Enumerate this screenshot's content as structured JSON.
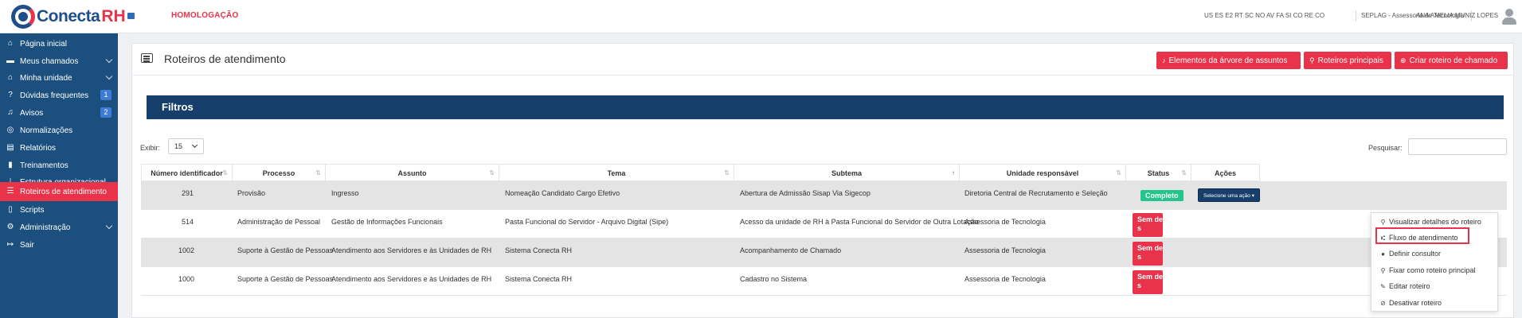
{
  "header": {
    "logo_text": "Conecta",
    "logo_rh": "RH",
    "environment": "HOMOLOGAÇÃO",
    "codes": "US ES E2 RT SC NO AV FA SI CO RE CO",
    "org": "SEPLAG - Assessoria de Tecnologia",
    "user": "ANA AMELIA MUNIZ LOPES"
  },
  "sidebar": {
    "items": [
      {
        "label": "Página inicial",
        "icon": "home-icon"
      },
      {
        "label": "Meus chamados",
        "icon": "inbox-icon"
      },
      {
        "label": "Minha unidade",
        "icon": "building-icon"
      },
      {
        "label": "Dúvidas frequentes",
        "icon": "question-icon",
        "badge": "1"
      },
      {
        "label": "Avisos",
        "icon": "bell-icon",
        "badge": "2"
      },
      {
        "label": "Normalizações",
        "icon": "compass-icon"
      },
      {
        "label": "Relatórios",
        "icon": "file-icon"
      },
      {
        "label": "Treinamentos",
        "icon": "book-icon"
      },
      {
        "label": "Estrutura organizacional",
        "icon": "sitemap-icon"
      },
      {
        "label": "Roteiros de atendimento",
        "icon": "list-icon",
        "active": true
      },
      {
        "label": "Scripts",
        "icon": "script-icon"
      },
      {
        "label": "Administração",
        "icon": "cogs-icon"
      },
      {
        "label": "Sair",
        "icon": "logout-icon"
      }
    ]
  },
  "page": {
    "title": "Roteiros de atendimento",
    "buttons": {
      "elementos": "Elementos da árvore de assuntos",
      "principais": "Roteiros principais",
      "criar": "Criar roteiro de chamado"
    },
    "filters_title": "Filtros",
    "exibir_label": "Exibir:",
    "exibir_value": "15",
    "search_label": "Pesquisar:",
    "search_value": ""
  },
  "table": {
    "columns": [
      "Número identificador",
      "Processo",
      "Assunto",
      "Tema",
      "Subtema",
      "Unidade responsável",
      "Status",
      "Ações"
    ],
    "rows": [
      {
        "id": "291",
        "processo": "Provisão",
        "assunto": "Ingresso",
        "tema": "Nomeação Candidato Cargo Efetivo",
        "subtema": "Abertura de Admissão Sisap Via Sigecop",
        "unidade": "Diretoria Central de Recrutamento e Seleção",
        "status": "Completo"
      },
      {
        "id": "514",
        "processo": "Administração de Pessoal",
        "assunto": "Gestão de Informações Funcionais",
        "tema": "Pasta Funcional do Servidor - Arquivo Digital (Sipe)",
        "subtema": "Acesso da unidade de RH à Pasta Funcional do Servidor de Outra Lotação",
        "unidade": "Assessoria de Tecnologia",
        "status": "Sem de s"
      },
      {
        "id": "1002",
        "processo": "Suporte à Gestão de Pessoas",
        "assunto": "Atendimento aos Servidores e às Unidades de RH",
        "tema": "Sistema Conecta RH",
        "subtema": "Acompanhamento de Chamado",
        "unidade": "Assessoria de Tecnologia",
        "status": "Sem de s"
      },
      {
        "id": "1000",
        "processo": "Suporte à Gestão de Pessoas",
        "assunto": "Atendimento aos Servidores e às Unidades de RH",
        "tema": "Sistema Conecta RH",
        "subtema": "Cadastro no Sistema",
        "unidade": "Assessoria de Tecnologia",
        "status": "Sem de s"
      }
    ],
    "action_label": "Selecione uma ação"
  },
  "dropdown": {
    "items": [
      {
        "label": "Visualizar detalhes do roteiro",
        "icon": "search-icon"
      },
      {
        "label": "Fluxo de atendimento",
        "icon": "flow-icon"
      },
      {
        "label": "Definir consultor",
        "icon": "user-icon"
      },
      {
        "label": "Fixar como roteiro principal",
        "icon": "pin-icon"
      },
      {
        "label": "Editar roteiro",
        "icon": "edit-icon"
      },
      {
        "label": "Desativar roteiro",
        "icon": "ban-icon"
      }
    ]
  },
  "colors": {
    "sidebar": "#1b4f7e",
    "accent_red": "#e8334a",
    "filters_bar": "#173f6b",
    "status_green": "#22c58b"
  }
}
